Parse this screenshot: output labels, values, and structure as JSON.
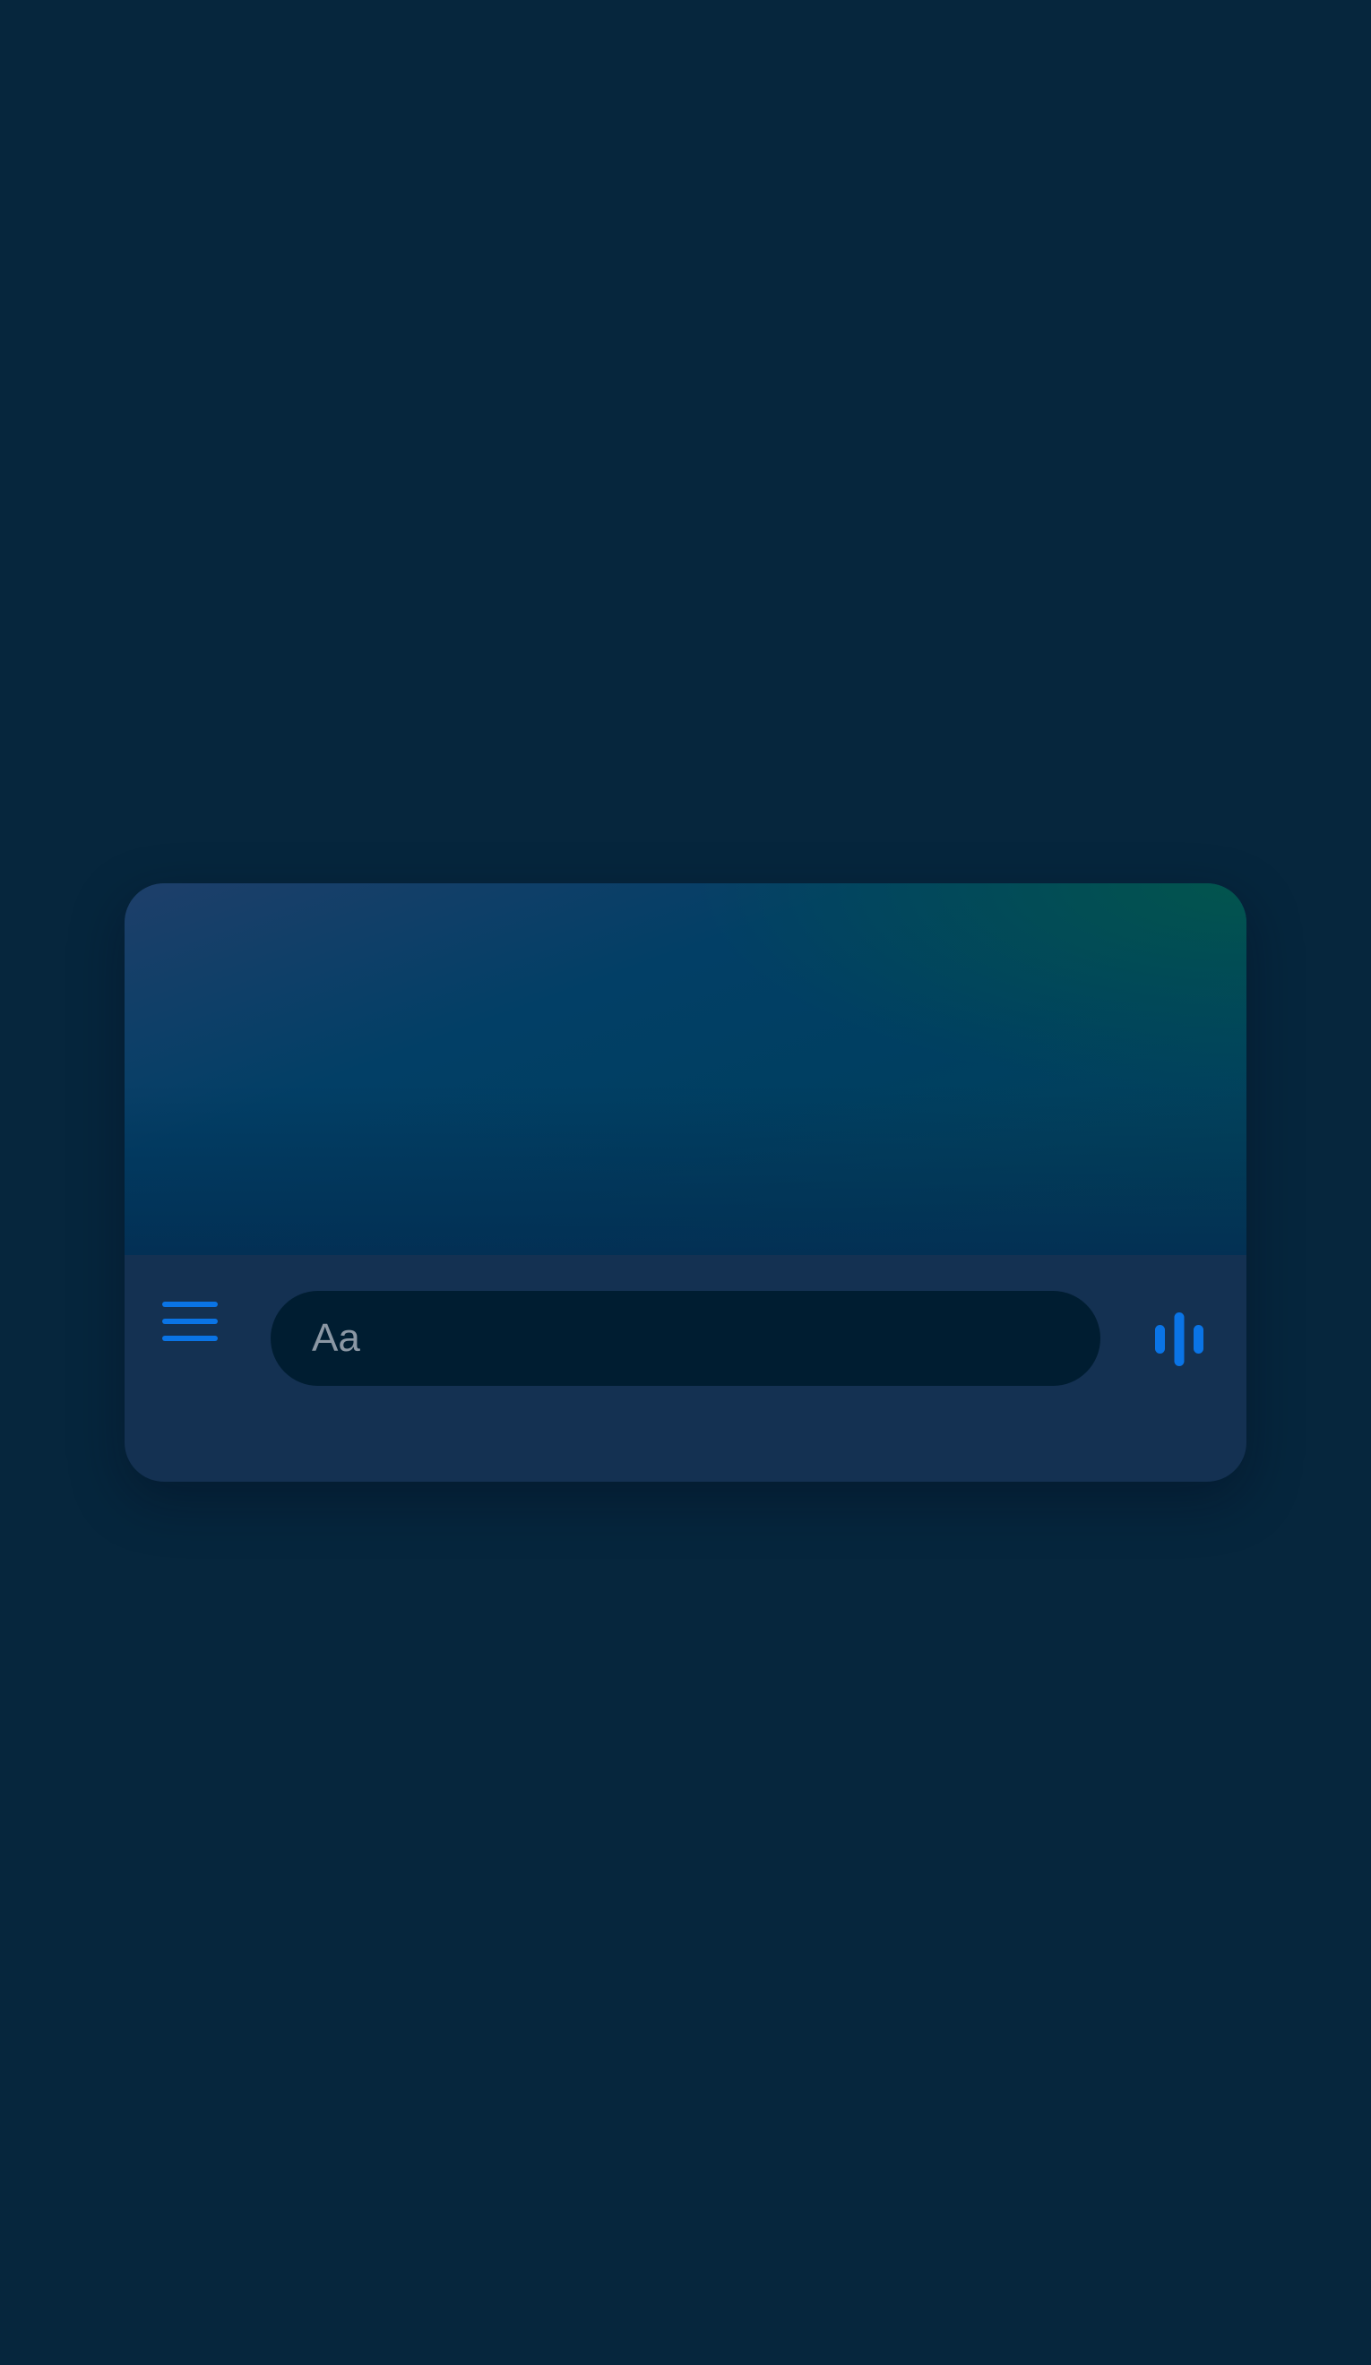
{
  "composer": {
    "placeholder": "Aa",
    "value": ""
  },
  "icons": {
    "menu": "hamburger-menu-icon",
    "voice": "voice-waveform-icon"
  },
  "colors": {
    "page_background": "#06263d",
    "card_background": "#143152",
    "input_background": "#001d31",
    "accent": "#0a74e6",
    "placeholder_text": "#8b97a4"
  }
}
